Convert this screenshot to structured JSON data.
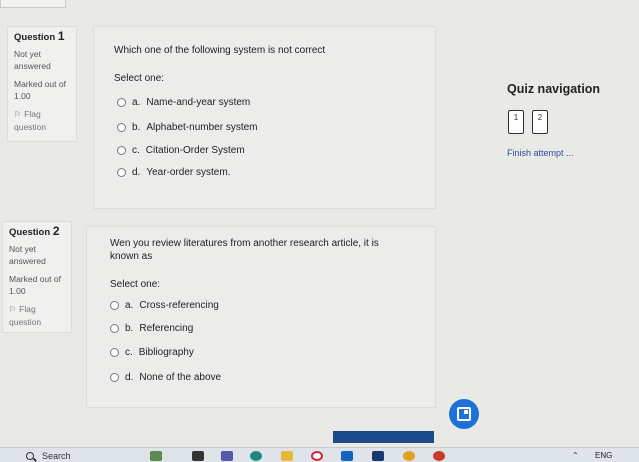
{
  "colors": {
    "link": "#2b4ea2",
    "accent": "#1d6fd9",
    "finish_bar": "#1d4a8a"
  },
  "questions": [
    {
      "number_label": "Question",
      "number": "1",
      "status_line1": "Not yet",
      "status_line2": "answered",
      "marked_line1": "Marked out of",
      "marked_line2": "1.00",
      "flag_line1": "Flag",
      "flag_line2": "question",
      "text_line1": "Which one of the following system is not correct",
      "text_line2": "",
      "select_one": "Select one:",
      "options": [
        {
          "letter": "a.",
          "text": "Name-and-year system"
        },
        {
          "letter": "b.",
          "text": "Alphabet-number system"
        },
        {
          "letter": "c.",
          "text": "Citation-Order System"
        },
        {
          "letter": "d.",
          "text": "Year-order system."
        }
      ]
    },
    {
      "number_label": "Question",
      "number": "2",
      "status_line1": "Not yet",
      "status_line2": "answered",
      "marked_line1": "Marked out of",
      "marked_line2": "1.00",
      "flag_line1": "Flag",
      "flag_line2": "question",
      "text_line1": "Wen you review literatures from another research article, it is",
      "text_line2": "known as",
      "select_one": "Select one:",
      "options": [
        {
          "letter": "a.",
          "text": "Cross-referencing"
        },
        {
          "letter": "b.",
          "text": "Referencing"
        },
        {
          "letter": "c.",
          "text": "Bibliography"
        },
        {
          "letter": "d.",
          "text": "None of the above"
        }
      ]
    }
  ],
  "quiz_nav": {
    "title": "Quiz navigation",
    "buttons": [
      "1",
      "2"
    ],
    "finish": "Finish attempt ..."
  },
  "taskbar": {
    "search": "Search",
    "lang": "ENG"
  }
}
